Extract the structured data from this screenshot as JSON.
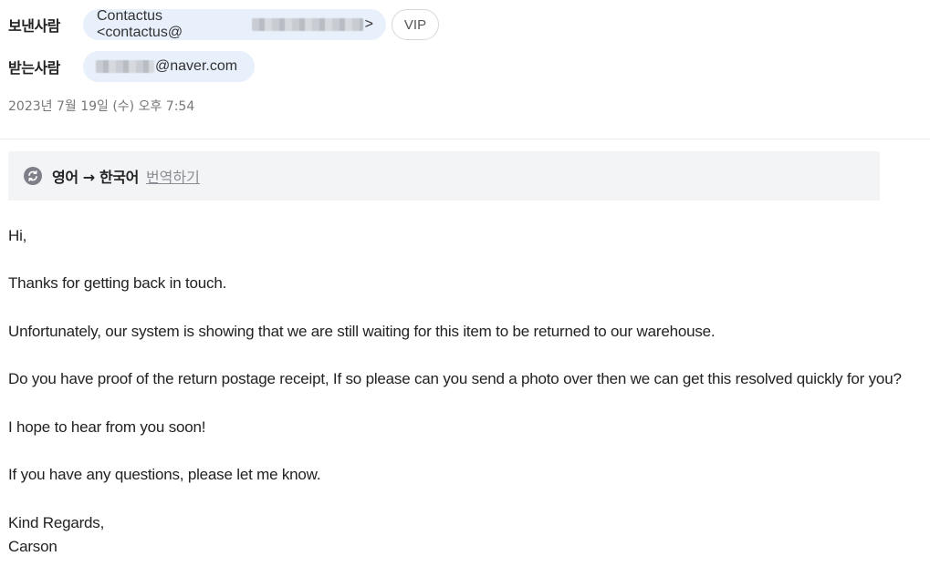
{
  "header": {
    "sender_label": "보낸사람",
    "sender_name": "Contactus <contactus@",
    "sender_suffix": ">",
    "vip_label": "VIP",
    "recipient_label": "받는사람",
    "recipient_suffix": "@naver.com",
    "date": "2023년 7월 19일 (수) 오후 7:54"
  },
  "translation": {
    "icon": "translate-icon",
    "languages": "영어 → 한국어",
    "action_label": "번역하기"
  },
  "message": {
    "lines": [
      "Hi,",
      "Thanks for getting back in touch.",
      "Unfortunately, our system is showing that we are still waiting for this item to be returned to our warehouse.",
      "Do you have proof of the return postage receipt, If so please can you send a photo over then we can get this resolved quickly for you?",
      "I hope to hear from you soon!",
      "If you have any questions, please let me know.",
      "Kind Regards,",
      "Carson"
    ]
  },
  "colors": {
    "chip_background": "#e8f0fb",
    "translate_bar_background": "#f3f4f6",
    "link_gray": "#8a8d93"
  }
}
